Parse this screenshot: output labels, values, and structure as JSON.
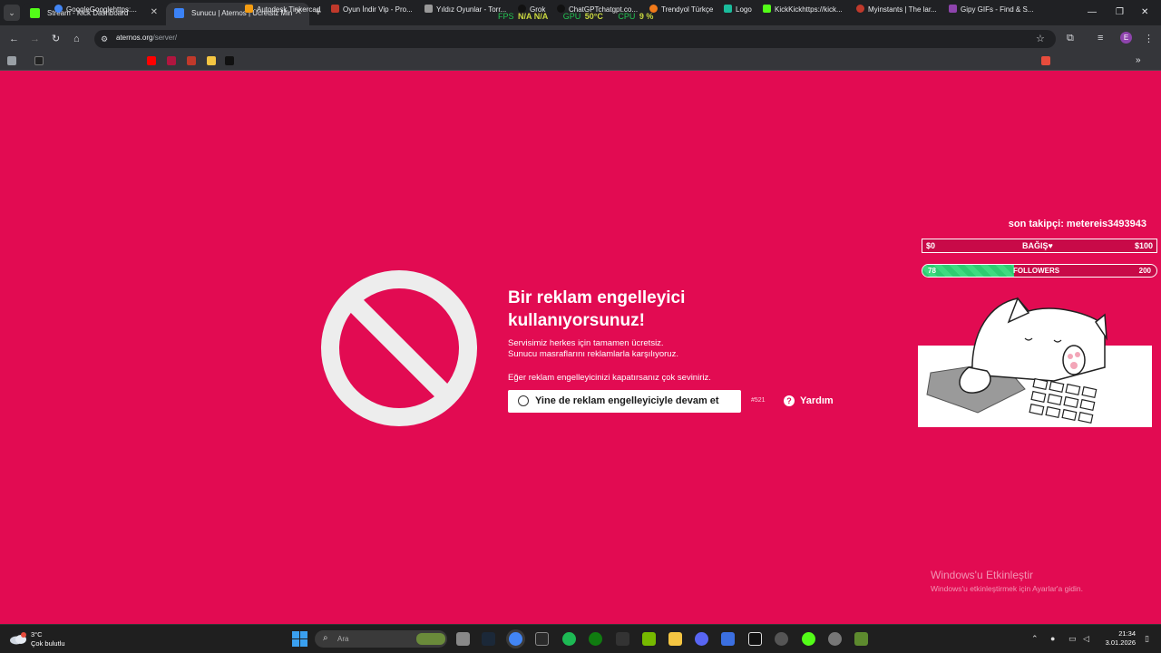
{
  "browser": {
    "tabs": [
      {
        "title": "Stream - Kick Dashboard",
        "active": false
      },
      {
        "title": "Sunucu | Aternos | Ücretsiz Min",
        "active": true
      }
    ],
    "url_domain": "aternos.org",
    "url_path": "/server/",
    "profile_initial": "E",
    "bookmarks": [
      "GoogleGooglehttps:...",
      "Autodesk Tinkercad",
      "Oyun İndir Vip - Pro...",
      "Yıldız Oyunlar - Torr...",
      "Grok",
      "ChatGPTchatgpt.co...",
      "Trendyol Türkçe",
      "Logo",
      "KickKickhttps://kick...",
      "Myinstants | The lar...",
      "Gipy GIFs - Find & S..."
    ]
  },
  "perf_overlay": {
    "fps_label": "FPS",
    "fps_values": "N/A  N/A",
    "gpu_label": "GPU",
    "gpu_value": "50°C",
    "cpu_label": "CPU",
    "cpu_value": "9 %"
  },
  "page": {
    "headline_line1": "Bir reklam engelleyici",
    "headline_line2": "kullanıyorsunuz!",
    "sub1": "Servisimiz herkes için tamamen ücretsiz.",
    "sub2": "Sunucu masraflarını reklamlarla karşılıyoruz.",
    "sub3": "Eğer reklam engelleyicinizi kapatırsanız çok seviniriz.",
    "continue_label": "Yine de reklam engelleyiciyle devam et",
    "error_code": "#521",
    "help_label": "Yardım",
    "bg_color": "#e20b52"
  },
  "stream_overlay": {
    "last_follower": "son takipçi: metereis3493943",
    "donation_min": "$0",
    "donation_label": "BAĞIŞ♥",
    "donation_max": "$100",
    "followers_current": "78",
    "followers_label": "FOLLOWERS",
    "followers_goal": "200",
    "followers_progress": 0.39
  },
  "watermark": {
    "line1": "Windows'u Etkinleştir",
    "line2": "Windows'u etkinleştirmek için Ayarlar'a gidin."
  },
  "taskbar": {
    "temperature": "3°C",
    "weather_text": "Çok bulutlu",
    "search_placeholder": "Ara",
    "time": "21:34",
    "date": "3.01.2026"
  }
}
